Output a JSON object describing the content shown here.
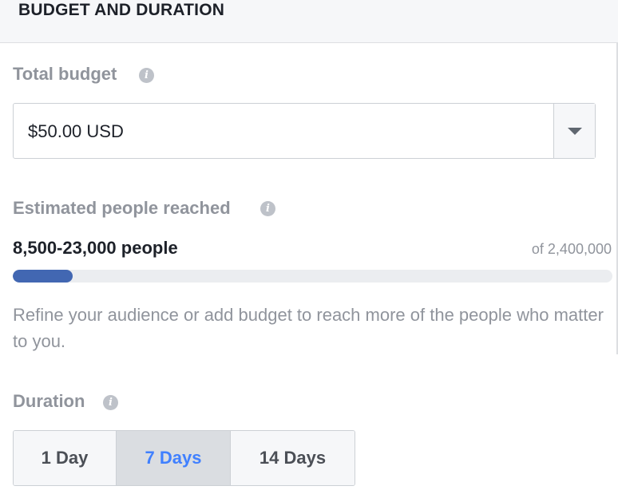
{
  "header": {
    "title": "BUDGET AND DURATION"
  },
  "budget": {
    "label": "Total budget",
    "info_icon": "info-icon",
    "value": "$50.00 USD",
    "dropdown_icon": "caret-down-icon"
  },
  "reach": {
    "label": "Estimated people reached",
    "info_icon": "info-icon",
    "value": "8,500-23,000 people",
    "total": "of 2,400,000",
    "progress_fraction": 0.1,
    "progress_color": "#4267b2",
    "hint": "Refine your audience or add budget to reach more of the people who matter to you."
  },
  "duration": {
    "label": "Duration",
    "info_icon": "info-icon",
    "options": [
      {
        "label": "1 Day",
        "selected": false
      },
      {
        "label": "7 Days",
        "selected": true
      },
      {
        "label": "14 Days",
        "selected": false
      }
    ],
    "selected_color": "#4080ff"
  }
}
